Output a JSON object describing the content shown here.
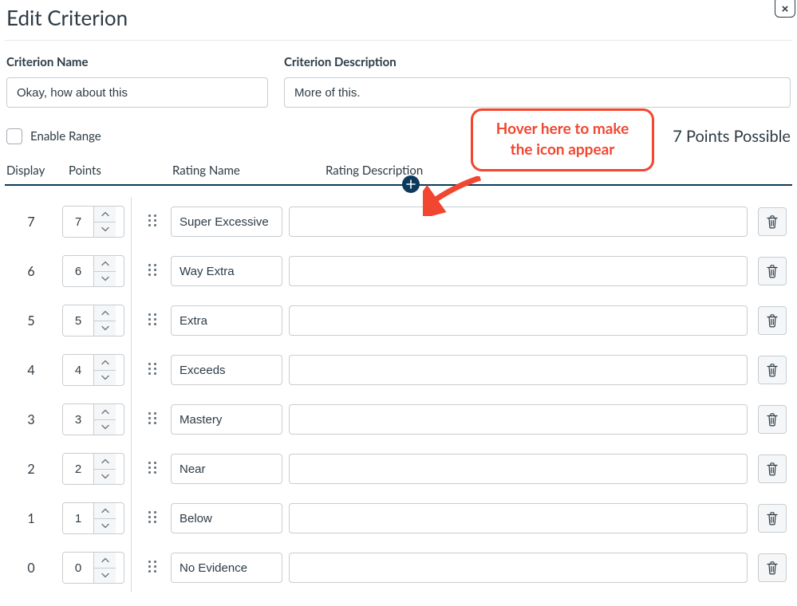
{
  "title": "Edit Criterion",
  "labels": {
    "criterion_name": "Criterion Name",
    "criterion_description": "Criterion Description",
    "enable_range": "Enable Range",
    "display": "Display",
    "points": "Points",
    "rating_name": "Rating Name",
    "rating_description": "Rating Description"
  },
  "fields": {
    "criterion_name": "Okay, how about this",
    "criterion_description": "More of this."
  },
  "points_possible_text": "7 Points Possible",
  "enable_range_checked": false,
  "annotation": {
    "text": "Hover here to make the icon appear"
  },
  "ratings": [
    {
      "display": "7",
      "points": "7",
      "name": "Super Excessive",
      "description": ""
    },
    {
      "display": "6",
      "points": "6",
      "name": "Way Extra",
      "description": ""
    },
    {
      "display": "5",
      "points": "5",
      "name": "Extra",
      "description": ""
    },
    {
      "display": "4",
      "points": "4",
      "name": "Exceeds",
      "description": ""
    },
    {
      "display": "3",
      "points": "3",
      "name": "Mastery",
      "description": ""
    },
    {
      "display": "2",
      "points": "2",
      "name": "Near",
      "description": ""
    },
    {
      "display": "1",
      "points": "1",
      "name": "Below",
      "description": ""
    },
    {
      "display": "0",
      "points": "0",
      "name": "No Evidence",
      "description": ""
    }
  ]
}
